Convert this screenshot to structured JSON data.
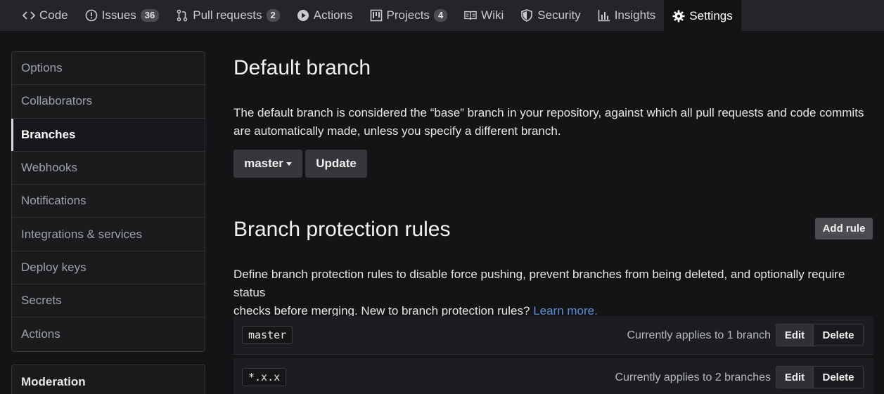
{
  "tabs": [
    {
      "label": "Code",
      "icon": "code-icon",
      "count": ""
    },
    {
      "label": "Issues",
      "icon": "issue-icon",
      "count": "36"
    },
    {
      "label": "Pull requests",
      "icon": "pull-request-icon",
      "count": "2"
    },
    {
      "label": "Actions",
      "icon": "play-icon",
      "count": ""
    },
    {
      "label": "Projects",
      "icon": "project-icon",
      "count": "4"
    },
    {
      "label": "Wiki",
      "icon": "book-icon",
      "count": ""
    },
    {
      "label": "Security",
      "icon": "shield-icon",
      "count": ""
    },
    {
      "label": "Insights",
      "icon": "graph-icon",
      "count": ""
    },
    {
      "label": "Settings",
      "icon": "gear-icon",
      "count": ""
    }
  ],
  "sidebar": {
    "items": [
      {
        "label": "Options"
      },
      {
        "label": "Collaborators"
      },
      {
        "label": "Branches"
      },
      {
        "label": "Webhooks"
      },
      {
        "label": "Notifications"
      },
      {
        "label": "Integrations & services"
      },
      {
        "label": "Deploy keys"
      },
      {
        "label": "Secrets"
      },
      {
        "label": "Actions"
      }
    ],
    "moderation_label": "Moderation"
  },
  "default_branch": {
    "title": "Default branch",
    "description_line1": "The default branch is considered the “base” branch in your repository, against which all pull requests and code commits",
    "description_line2": "are automatically made, unless you specify a different branch.",
    "branch_select_value": "master",
    "update_label": "Update"
  },
  "protection": {
    "title": "Branch protection rules",
    "add_rule_label": "Add rule",
    "description_line1": "Define branch protection rules to disable force pushing, prevent branches from being deleted, and optionally require status",
    "description_line2": "checks before merging. New to branch protection rules?",
    "learn_more": "Learn more.",
    "rules": [
      {
        "pattern": "master",
        "applies": "Currently applies to 1 branch",
        "edit": "Edit",
        "delete": "Delete"
      },
      {
        "pattern": "*.x.x",
        "applies": "Currently applies to 2 branches",
        "edit": "Edit",
        "delete": "Delete"
      }
    ]
  },
  "colors": {
    "background": "#131416",
    "topnav": "#242528",
    "link": "#5b8fd6"
  }
}
